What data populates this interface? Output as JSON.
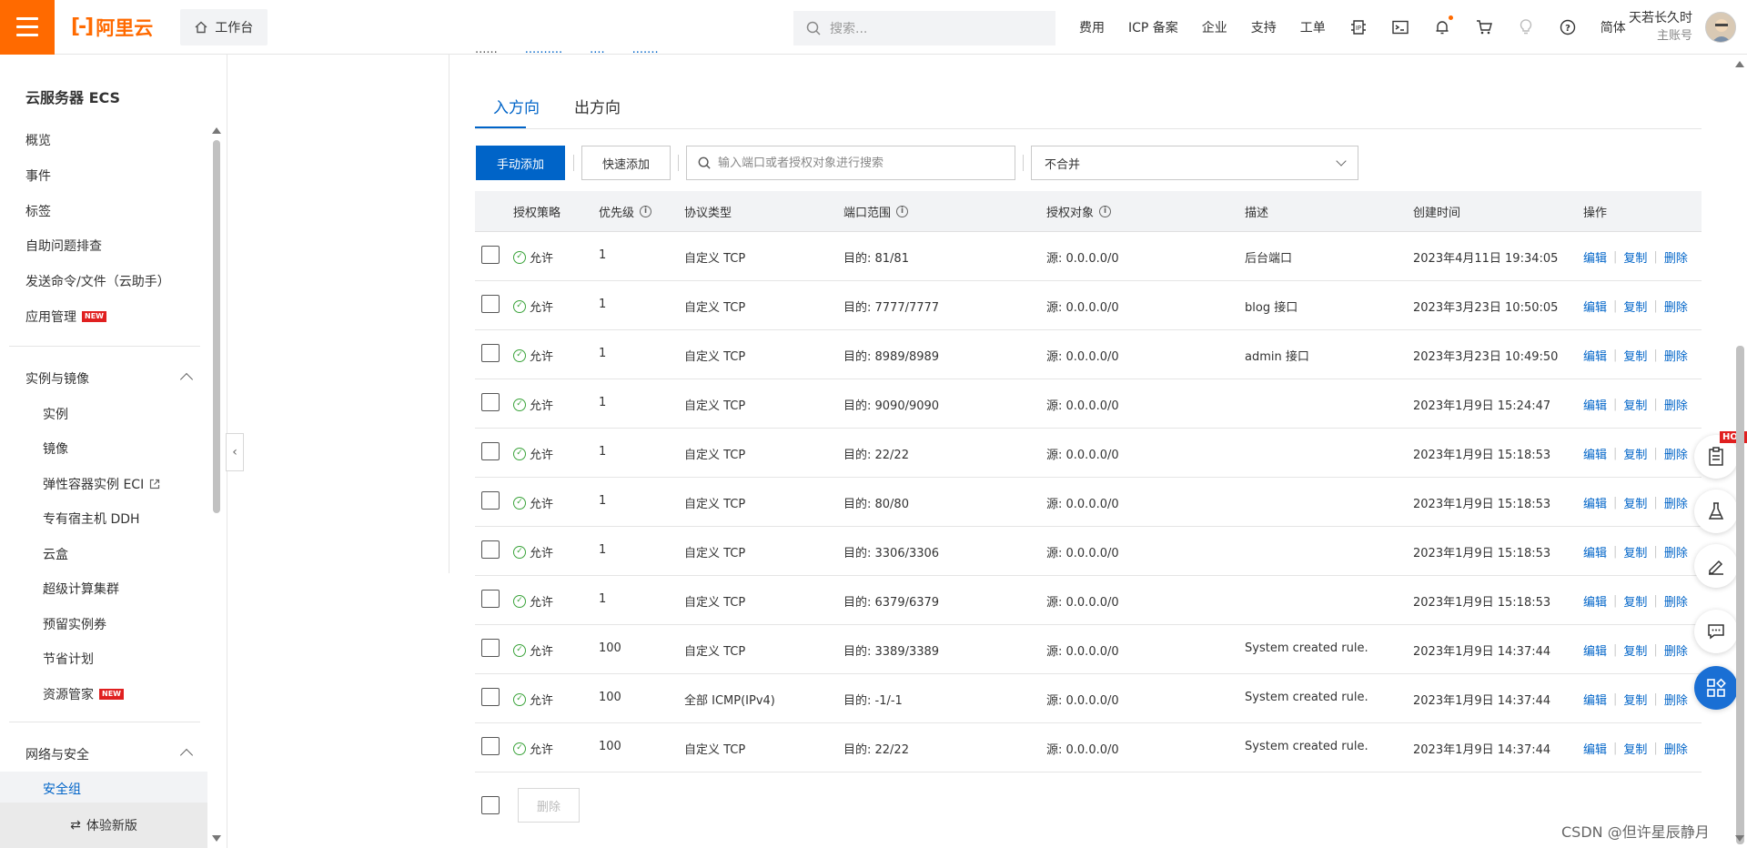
{
  "header": {
    "logo_text": "阿里云",
    "workbench_label": "工作台",
    "search_placeholder": "搜索...",
    "nav": [
      "费用",
      "ICP 备案",
      "企业",
      "支持",
      "工单"
    ],
    "lang": "简体",
    "account_name": "天若长久时",
    "account_role": "主账号"
  },
  "sidebar": {
    "title": "云服务器 ECS",
    "items": [
      "概览",
      "事件",
      "标签",
      "自助问题排查",
      "发送命令/文件（云助手）",
      "应用管理"
    ],
    "new_badge": "NEW",
    "group1_title": "实例与镜像",
    "group1_items": [
      "实例",
      "镜像",
      "弹性容器实例 ECI",
      "专有宿主机 DDH",
      "云盒",
      "超级计算集群",
      "预留实例券",
      "节省计划",
      "资源管家"
    ],
    "group2_title": "网络与安全",
    "group2_items": [
      "安全组"
    ],
    "footer": "体验新版"
  },
  "tabs": {
    "inbound": "入方向",
    "outbound": "出方向"
  },
  "toolbar": {
    "manual_add": "手动添加",
    "quick_add": "快速添加",
    "search_placeholder": "输入端口或者授权对象进行搜索",
    "merge_select": "不合并"
  },
  "table": {
    "headers": {
      "policy": "授权策略",
      "priority": "优先级",
      "protocol": "协议类型",
      "port": "端口范围",
      "source": "授权对象",
      "desc": "描述",
      "created": "创建时间",
      "ops": "操作"
    },
    "ops_labels": {
      "edit": "编辑",
      "copy": "复制",
      "delete": "删除"
    },
    "rows": [
      {
        "policy": "允许",
        "priority": "1",
        "protocol": "自定义 TCP",
        "port": "目的: 81/81",
        "source": "源: 0.0.0.0/0",
        "desc": "后台端口",
        "created": "2023年4月11日 19:34:05"
      },
      {
        "policy": "允许",
        "priority": "1",
        "protocol": "自定义 TCP",
        "port": "目的: 7777/7777",
        "source": "源: 0.0.0.0/0",
        "desc": "blog 接口",
        "created": "2023年3月23日 10:50:05"
      },
      {
        "policy": "允许",
        "priority": "1",
        "protocol": "自定义 TCP",
        "port": "目的: 8989/8989",
        "source": "源: 0.0.0.0/0",
        "desc": "admin 接口",
        "created": "2023年3月23日 10:49:50"
      },
      {
        "policy": "允许",
        "priority": "1",
        "protocol": "自定义 TCP",
        "port": "目的: 9090/9090",
        "source": "源: 0.0.0.0/0",
        "desc": "",
        "created": "2023年1月9日 15:24:47"
      },
      {
        "policy": "允许",
        "priority": "1",
        "protocol": "自定义 TCP",
        "port": "目的: 22/22",
        "source": "源: 0.0.0.0/0",
        "desc": "",
        "created": "2023年1月9日 15:18:53"
      },
      {
        "policy": "允许",
        "priority": "1",
        "protocol": "自定义 TCP",
        "port": "目的: 80/80",
        "source": "源: 0.0.0.0/0",
        "desc": "",
        "created": "2023年1月9日 15:18:53"
      },
      {
        "policy": "允许",
        "priority": "1",
        "protocol": "自定义 TCP",
        "port": "目的: 3306/3306",
        "source": "源: 0.0.0.0/0",
        "desc": "",
        "created": "2023年1月9日 15:18:53"
      },
      {
        "policy": "允许",
        "priority": "1",
        "protocol": "自定义 TCP",
        "port": "目的: 6379/6379",
        "source": "源: 0.0.0.0/0",
        "desc": "",
        "created": "2023年1月9日 15:18:53"
      },
      {
        "policy": "允许",
        "priority": "100",
        "protocol": "自定义 TCP",
        "port": "目的: 3389/3389",
        "source": "源: 0.0.0.0/0",
        "desc": "System created rule.",
        "created": "2023年1月9日 14:37:44"
      },
      {
        "policy": "允许",
        "priority": "100",
        "protocol": "全部 ICMP(IPv4)",
        "port": "目的: -1/-1",
        "source": "源: 0.0.0.0/0",
        "desc": "System created rule.",
        "created": "2023年1月9日 14:37:44"
      },
      {
        "policy": "允许",
        "priority": "100",
        "protocol": "自定义 TCP",
        "port": "目的: 22/22",
        "source": "源: 0.0.0.0/0",
        "desc": "System created rule.",
        "created": "2023年1月9日 14:37:44"
      }
    ]
  },
  "footer": {
    "delete_button": "删除"
  },
  "floating": {
    "hot_badge": "HOT"
  },
  "watermark": "CSDN @但许星辰静月"
}
